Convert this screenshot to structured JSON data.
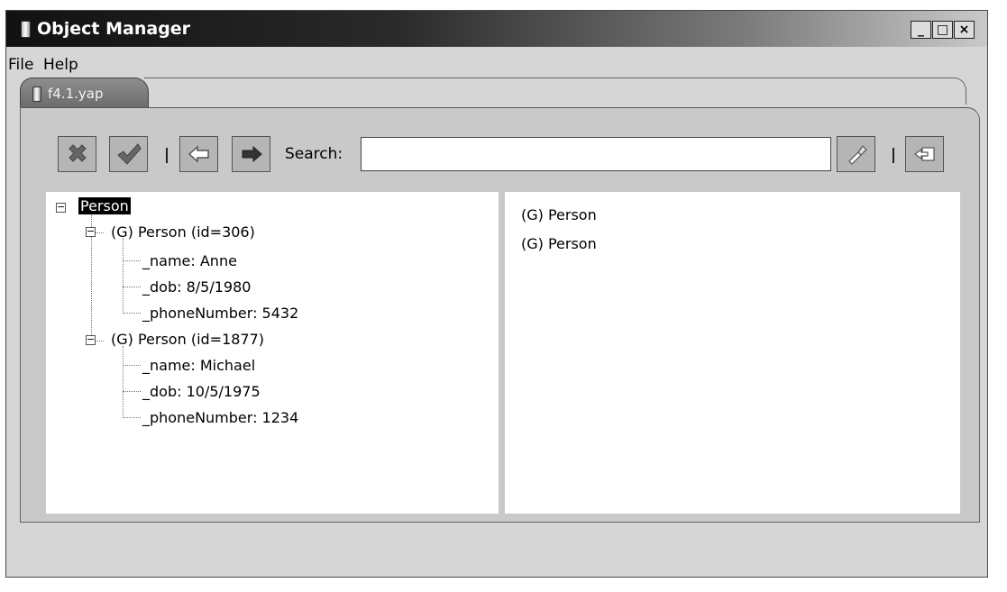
{
  "window": {
    "title": "Object Manager",
    "minimize": "_",
    "maximize": "□",
    "close": "×"
  },
  "menu": [
    "File",
    "Help"
  ],
  "tab": {
    "label": "f4.1.yap"
  },
  "toolbar": {
    "search_label": "Search:",
    "search_value": ""
  },
  "tree": {
    "root": "Person",
    "objects": [
      {
        "label": "(G) Person (id=306)",
        "fields": [
          "_name: Anne",
          "_dob: 8/5/1980",
          "_phoneNumber: 5432"
        ]
      },
      {
        "label": "(G) Person (id=1877)",
        "fields": [
          "_name: Michael",
          "_dob: 10/5/1975",
          "_phoneNumber: 1234"
        ]
      }
    ]
  },
  "right_list": [
    "(G) Person",
    "(G) Person"
  ]
}
